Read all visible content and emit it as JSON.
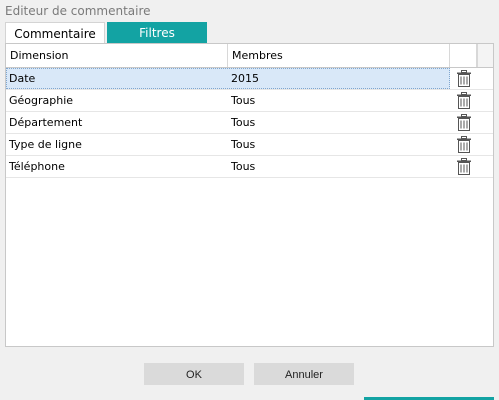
{
  "window": {
    "title": "Editeur de commentaire"
  },
  "tabs": [
    {
      "label": "Commentaire",
      "active": false
    },
    {
      "label": "Filtres",
      "active": true
    }
  ],
  "grid": {
    "columns": [
      "Dimension",
      "Membres"
    ],
    "rows": [
      {
        "dimension": "Date",
        "membres": "2015",
        "selected": true
      },
      {
        "dimension": "Géographie",
        "membres": "Tous"
      },
      {
        "dimension": "Département",
        "membres": "Tous"
      },
      {
        "dimension": "Type de ligne",
        "membres": "Tous"
      },
      {
        "dimension": "Téléphone",
        "membres": "Tous"
      }
    ],
    "row_action_icon": "trash-icon"
  },
  "buttons": {
    "ok": "OK",
    "cancel": "Annuler"
  },
  "colors": {
    "accent": "#13a3a3",
    "selection": "#d9e8f8",
    "background": "#f0f0f0"
  }
}
